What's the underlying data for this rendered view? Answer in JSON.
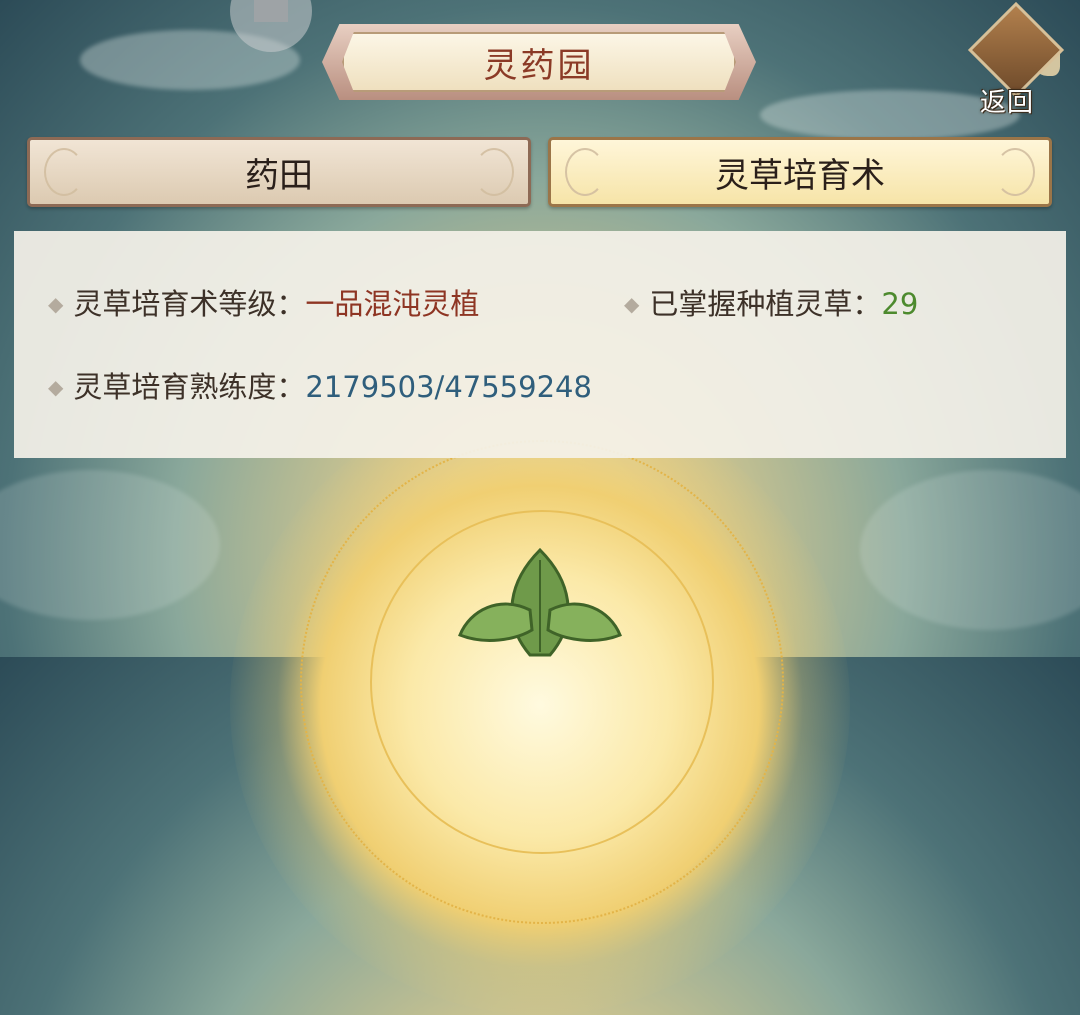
{
  "header": {
    "title": "灵药园",
    "back_label": "返回"
  },
  "tabs": [
    {
      "label": "药田",
      "active": false
    },
    {
      "label": "灵草培育术",
      "active": true
    }
  ],
  "info": {
    "level_label": "灵草培育术等级：",
    "level_value": "一品混沌灵植",
    "mastered_label": "已掌握种植灵草：",
    "mastered_value": "29",
    "proficiency_label": "灵草培育熟练度：",
    "proficiency_value": "2179503/47559248"
  },
  "icons": {
    "puzzle": "puzzle-icon",
    "back": "return-icon",
    "leaf": "herb-leaf-icon",
    "bullet": "diamond-bullet-icon"
  },
  "colors": {
    "level_value": "#8e3523",
    "mastered_value": "#4d8a2e",
    "proficiency_value": "#2f5e7c"
  }
}
